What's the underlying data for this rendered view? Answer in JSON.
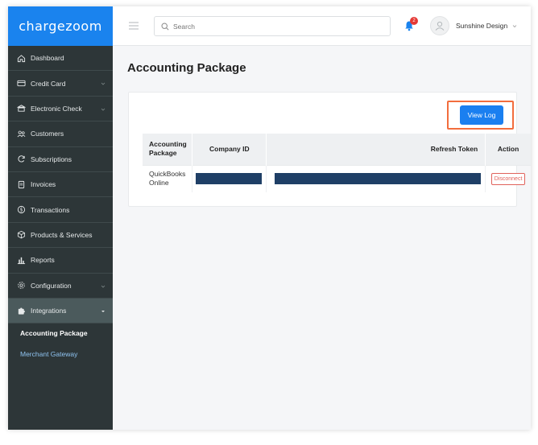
{
  "app": {
    "logo": "chargezoom"
  },
  "sidebar": {
    "items": [
      {
        "label": "Dashboard",
        "icon": "home-icon",
        "has_children": false,
        "active": false
      },
      {
        "label": "Credit Card",
        "icon": "credit-card-icon",
        "has_children": true,
        "active": false
      },
      {
        "label": "Electronic Check",
        "icon": "bank-icon",
        "has_children": true,
        "active": false
      },
      {
        "label": "Customers",
        "icon": "users-icon",
        "has_children": false,
        "active": false
      },
      {
        "label": "Subscriptions",
        "icon": "refresh-icon",
        "has_children": false,
        "active": false
      },
      {
        "label": "Invoices",
        "icon": "invoice-icon",
        "has_children": false,
        "active": false
      },
      {
        "label": "Transactions",
        "icon": "dollar-icon",
        "has_children": false,
        "active": false
      },
      {
        "label": "Products & Services",
        "icon": "box-icon",
        "has_children": false,
        "active": false
      },
      {
        "label": "Reports",
        "icon": "bar-chart-icon",
        "has_children": false,
        "active": false
      },
      {
        "label": "Configuration",
        "icon": "gear-icon",
        "has_children": true,
        "active": false
      },
      {
        "label": "Integrations",
        "icon": "puzzle-icon",
        "has_children": true,
        "active": true
      }
    ],
    "subitems": [
      {
        "label": "Accounting Package",
        "current": true
      },
      {
        "label": "Merchant Gateway",
        "current": false
      }
    ]
  },
  "topbar": {
    "search_placeholder": "Search",
    "notification_count": "2",
    "user_name": "Sunshine Design"
  },
  "main": {
    "title": "Accounting Package",
    "view_log_label": "View Log",
    "table": {
      "headers": [
        "Accounting Package",
        "Company ID",
        "Refresh Token",
        "Action"
      ],
      "rows": [
        {
          "package": "QuickBooks Online",
          "company_id": "",
          "refresh_token": "",
          "action": "Disconnect"
        }
      ]
    }
  },
  "colors": {
    "brand_blue": "#1a83ee",
    "sidebar_bg": "#2d3638",
    "highlight": "#f26d3d",
    "danger": "#e0625b",
    "redaction": "#1f3f66"
  }
}
